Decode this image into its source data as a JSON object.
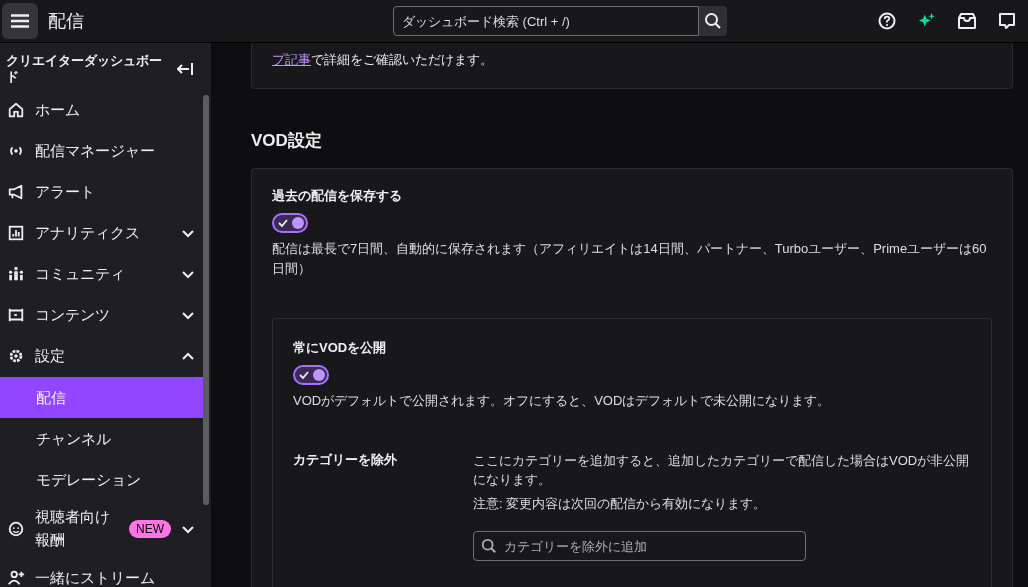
{
  "header": {
    "title": "配信",
    "search": {
      "placeholder": "ダッシュボード検索 (Ctrl + /)"
    }
  },
  "sidebar": {
    "title": "クリエイターダッシュボード",
    "items": [
      {
        "label": "ホーム"
      },
      {
        "label": "配信マネージャー"
      },
      {
        "label": "アラート"
      },
      {
        "label": "アナリティクス",
        "expanded": false
      },
      {
        "label": "コミュニティ",
        "expanded": false
      },
      {
        "label": "コンテンツ",
        "expanded": false
      },
      {
        "label": "設定",
        "expanded": true,
        "children": [
          {
            "label": "配信",
            "selected": true
          },
          {
            "label": "チャンネル",
            "selected": false
          },
          {
            "label": "モデレーション",
            "selected": false
          }
        ]
      },
      {
        "label": "視聴者向け報酬",
        "badge": "NEW",
        "expanded": false
      },
      {
        "label": "一緒にストリーム"
      }
    ]
  },
  "notice": {
    "link": "プ記事",
    "text": "で詳細をご確認いただけます。"
  },
  "vod": {
    "heading": "VOD設定",
    "save": {
      "label": "過去の配信を保存する",
      "on": true,
      "description": "配信は最長で7日間、自動的に保存されます（アフィリエイトは14日間、パートナー、Turboユーザー、Primeユーザーは60日間）"
    },
    "publish": {
      "label": "常にVODを公開",
      "on": true,
      "description": "VODがデフォルトで公開されます。オフにすると、VODはデフォルトで未公開になります。"
    },
    "exclude": {
      "label": "カテゴリーを除外",
      "description": "ここにカテゴリーを追加すると、追加したカテゴリーで配信した場合はVODが非公開になります。",
      "note": "注意: 変更内容は次回の配信から有効になります。",
      "placeholder": "カテゴリーを除外に追加"
    }
  }
}
